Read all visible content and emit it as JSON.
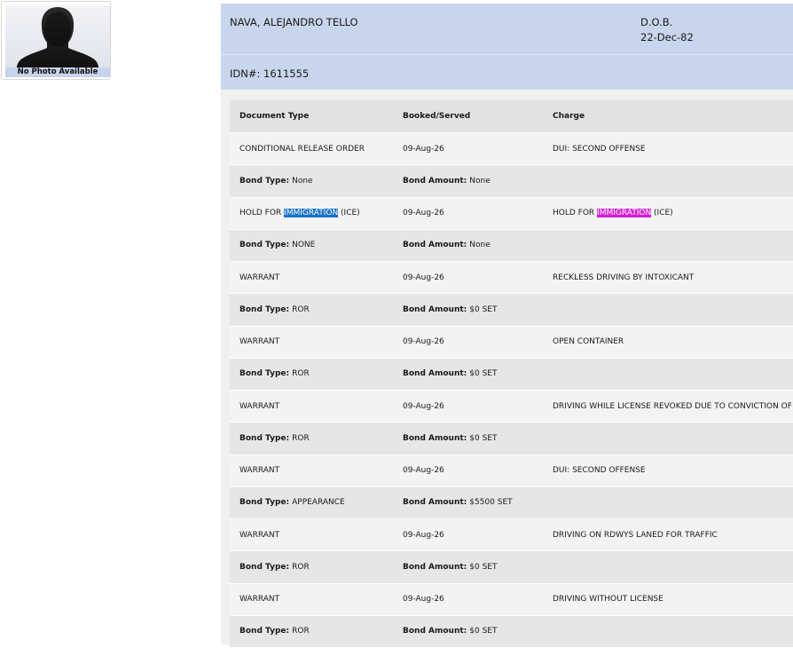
{
  "photo": {
    "caption": "No Photo Available",
    "icon": "person-silhouette-icon"
  },
  "inmate": {
    "name": "NAVA, ALEJANDRO TELLO",
    "dob_label": "D.O.B.",
    "dob_value": "22-Dec-82",
    "idn": "IDN#: 1611555"
  },
  "table": {
    "headers": {
      "document_type": "Document Type",
      "booked_served": "Booked/Served",
      "charge": "Charge"
    },
    "bond_type_label": "Bond Type:",
    "bond_amount_label": "Bond Amount:",
    "records": [
      {
        "doc_type": "CONDITIONAL RELEASE ORDER",
        "booked": "09-Aug-26",
        "charge": "DUI: SECOND OFFENSE",
        "bond_type": "None",
        "bond_amount": "None"
      },
      {
        "doc_type_pre": "HOLD FOR ",
        "doc_type_hl": "IMMIGRATION",
        "doc_type_post": " (ICE)",
        "booked": "09-Aug-26",
        "charge_pre": "HOLD FOR ",
        "charge_hl": "IMMIGRATION",
        "charge_post": " (ICE)",
        "bond_type": "NONE",
        "bond_amount": "None"
      },
      {
        "doc_type": "WARRANT",
        "booked": "09-Aug-26",
        "charge": "RECKLESS DRIVING BY INTOXICANT",
        "bond_type": "ROR",
        "bond_amount": "$0 SET"
      },
      {
        "doc_type": "WARRANT",
        "booked": "09-Aug-26",
        "charge": "OPEN CONTAINER",
        "bond_type": "ROR",
        "bond_amount": "$0 SET"
      },
      {
        "doc_type": "WARRANT",
        "booked": "09-Aug-26",
        "charge": "DRIVING WHILE LICENSE REVOKED DUE TO CONVICTION OF DUI",
        "bond_type": "ROR",
        "bond_amount": "$0 SET"
      },
      {
        "doc_type": "WARRANT",
        "booked": "09-Aug-26",
        "charge": "DUI: SECOND OFFENSE",
        "bond_type": "APPEARANCE",
        "bond_amount": "$5500 SET"
      },
      {
        "doc_type": "WARRANT",
        "booked": "09-Aug-26",
        "charge": "DRIVING ON RDWYS LANED FOR TRAFFIC",
        "bond_type": "ROR",
        "bond_amount": "$0 SET"
      },
      {
        "doc_type": "WARRANT",
        "booked": "09-Aug-26",
        "charge": "DRIVING WITHOUT LICENSE",
        "bond_type": "ROR",
        "bond_amount": "$0 SET"
      }
    ]
  },
  "colors": {
    "header_bg": "#c9d5ec",
    "highlight_blue": "#1a73c8",
    "highlight_magenta": "#d41fd4"
  }
}
